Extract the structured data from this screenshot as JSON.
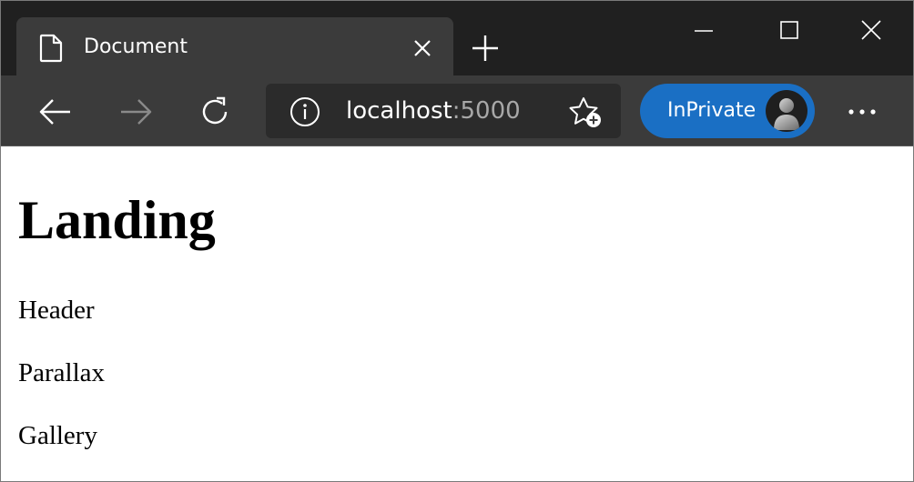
{
  "browser": {
    "tab": {
      "title": "Document",
      "icon": "document-icon"
    },
    "address": {
      "host": "localhost",
      "port": ":5000"
    },
    "profile": {
      "label": "InPrivate",
      "accent": "#1a6fc4"
    },
    "colors": {
      "titlebar": "#202020",
      "toolbar": "#3b3b3b",
      "addressbar": "#2b2b2b"
    }
  },
  "page": {
    "title": "Landing",
    "items": [
      {
        "label": "Header"
      },
      {
        "label": "Parallax"
      },
      {
        "label": "Gallery"
      }
    ]
  }
}
